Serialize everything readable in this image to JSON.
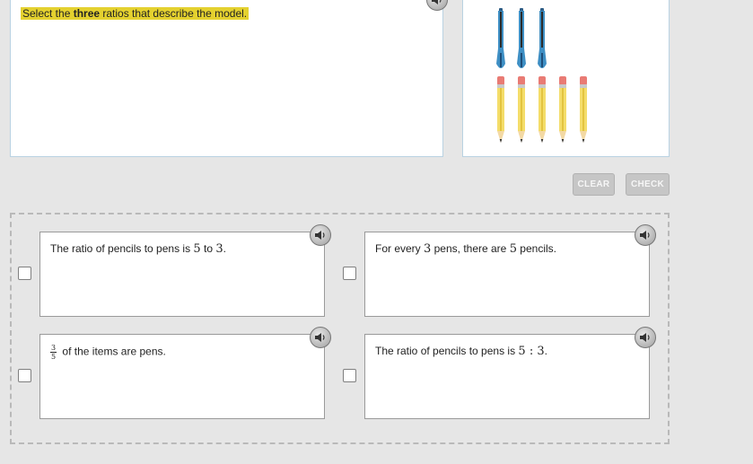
{
  "prompt": {
    "pre": "Select the ",
    "bold": "three",
    "post": " ratios that describe the model."
  },
  "model": {
    "pens": 3,
    "pencils": 5,
    "pen_color": "#3e8fc4",
    "pencil_color": "#f4dd6a",
    "eraser_color": "#e97b74"
  },
  "buttons": {
    "clear": "CLEAR",
    "check": "CHECK"
  },
  "choices": [
    {
      "t1": "The ratio of pencils to pens is ",
      "m1": "5",
      "t2": " to ",
      "m2": "3",
      "t3": "."
    },
    {
      "t1": "For every ",
      "m1": "3",
      "t2": " pens, there are ",
      "m2": "5",
      "t3": " pencils."
    },
    {
      "num": "3",
      "den": "5",
      "t1": " of the items are pens."
    },
    {
      "t1": "The ratio of pencils to pens is ",
      "m1": "5 : 3",
      "t3": "."
    }
  ],
  "icons": {
    "audio": "speaker-icon"
  }
}
